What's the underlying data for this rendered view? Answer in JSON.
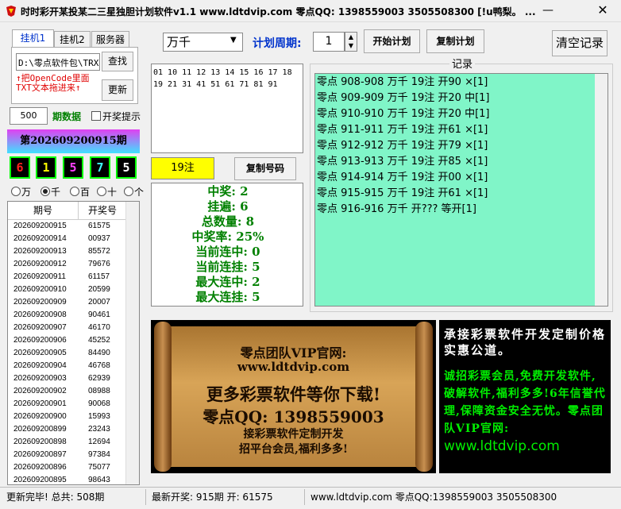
{
  "window": {
    "title": "时时彩开某投某二三星独胆计划软件v1.1    www.ldtdvip.com    零点QQ: 1398559003   3505508300 [!u鸭梨。   ...",
    "minimize_label": "—",
    "close_label": "✕"
  },
  "tabs": [
    {
      "label": "挂机1",
      "active": true
    },
    {
      "label": "挂机2",
      "active": false
    },
    {
      "label": "服务器",
      "active": false
    }
  ],
  "source": {
    "path_value": "D:\\零点软件包\\TRX",
    "find_label": "查找",
    "update_label": "更新",
    "hint": "↑把OpenCode里面TXT文本拖进来↑"
  },
  "periods": {
    "count_value": "500",
    "label": "期数据",
    "open_alert_label": "开奖提示"
  },
  "current_issue": {
    "label": "第202609200915期",
    "balls": [
      "6",
      "1",
      "5",
      "7",
      "5"
    ],
    "ball_colors": [
      "#ff2020",
      "#ffff00",
      "#ff40ff",
      "#40ffff",
      "#ffffff"
    ]
  },
  "positions": [
    {
      "label": "万",
      "selected": false
    },
    {
      "label": "千",
      "selected": true
    },
    {
      "label": "百",
      "selected": false
    },
    {
      "label": "十",
      "selected": false
    },
    {
      "label": "个",
      "selected": false
    }
  ],
  "history": {
    "headers": [
      "期号",
      "开奖号"
    ],
    "rows": [
      [
        "202609200915",
        "61575"
      ],
      [
        "202609200914",
        "00937"
      ],
      [
        "202609200913",
        "85572"
      ],
      [
        "202609200912",
        "79676"
      ],
      [
        "202609200911",
        "61157"
      ],
      [
        "202609200910",
        "20599"
      ],
      [
        "202609200909",
        "20007"
      ],
      [
        "202609200908",
        "90461"
      ],
      [
        "202609200907",
        "46170"
      ],
      [
        "202609200906",
        "45252"
      ],
      [
        "202609200905",
        "84490"
      ],
      [
        "202609200904",
        "46768"
      ],
      [
        "202609200903",
        "62939"
      ],
      [
        "202609200902",
        "08988"
      ],
      [
        "202609200901",
        "90068"
      ],
      [
        "202609200900",
        "15993"
      ],
      [
        "202609200899",
        "23243"
      ],
      [
        "202609200898",
        "12694"
      ],
      [
        "202609200897",
        "97384"
      ],
      [
        "202609200896",
        "75077"
      ],
      [
        "202609200895",
        "98643"
      ]
    ]
  },
  "toolbar": {
    "position_value": "万千",
    "cycle_label": "计划周期:",
    "cycle_value": "1",
    "start_plan_label": "开始计划",
    "copy_plan_label": "复制计划",
    "clear_label": "清空记录"
  },
  "numbers": {
    "text": "01 10 11 12 13 14 15 16 17 18 19 21 31 41 51 61 71 81 91",
    "bet_count": "19注",
    "copy_label": "复制号码"
  },
  "stats": [
    "中奖: 2",
    "挂遍: 6",
    "总数量: 8",
    "中奖率: 25%",
    "当前连中: 0",
    "当前连挂: 5",
    "最大连中: 2",
    "最大连挂: 5"
  ],
  "records": {
    "label": "记录",
    "items": [
      "零点 908-908 万千 19注 开90 ×[1]",
      "零点 909-909 万千 19注 开20 中[1]",
      "零点 910-910 万千 19注 开20 中[1]",
      "零点 911-911 万千 19注 开61 ×[1]",
      "零点 912-912 万千 19注 开79 ×[1]",
      "零点 913-913 万千 19注 开85 ×[1]",
      "零点 914-914 万千 19注 开00 ×[1]",
      "零点 915-915 万千 19注 开61 ×[1]",
      "零点 916-916 万千 开???  等开[1]"
    ]
  },
  "banner": {
    "line1": "零点团队VIP官网:",
    "line2": "www.ldtdvip.com",
    "line3": "更多彩票软件等你下载!",
    "line4": "零点QQ: 1398559003",
    "line5": "接彩票软件定制开发",
    "line6": "招平台会员,福利多多!"
  },
  "promo": {
    "line1": "承接彩票软件开发定制价格实惠公道。",
    "line2": "诚招彩票会员,免费开发软件,破解软件,福利多多!6年信誉代理,保障资金安全无忧。零点团队VIP官网:",
    "url": "www.ldtdvip.com"
  },
  "status": {
    "left": "更新完毕! 总共: 508期",
    "middle": "最新开奖: 915期 开: 61575",
    "right": "www.ldtdvip.com 零点QQ:1398559003  3505508300"
  }
}
